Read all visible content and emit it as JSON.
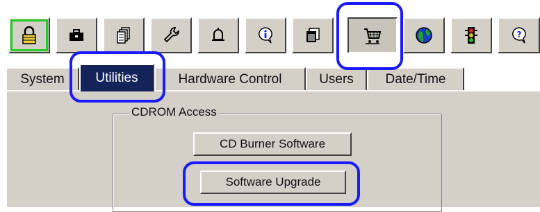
{
  "toolbar": {
    "buttons": [
      {
        "icon": "lock-icon",
        "active": true
      },
      {
        "icon": "toolbox-icon"
      },
      {
        "icon": "documents-icon"
      },
      {
        "icon": "wrench-icon"
      },
      {
        "icon": "bell-icon"
      },
      {
        "icon": "info-icon"
      },
      {
        "icon": "windows-icon"
      },
      {
        "icon": "shopping-cart-icon",
        "pressed": true
      },
      {
        "icon": "globe-icon"
      },
      {
        "icon": "traffic-light-icon"
      },
      {
        "icon": "help-icon"
      }
    ]
  },
  "tabs": [
    "System",
    "Utilities",
    "Hardware Control",
    "Users",
    "Date/Time"
  ],
  "active_tab": "Utilities",
  "group": {
    "legend": "CDROM Access",
    "buttons": [
      "CD Burner Software",
      "Software Upgrade"
    ]
  },
  "colors": {
    "highlight": "#1a1aff",
    "active_tab_bg": "#14245a",
    "lock_outline": "#22cc22",
    "panel_bg": "#d4d0c8"
  }
}
